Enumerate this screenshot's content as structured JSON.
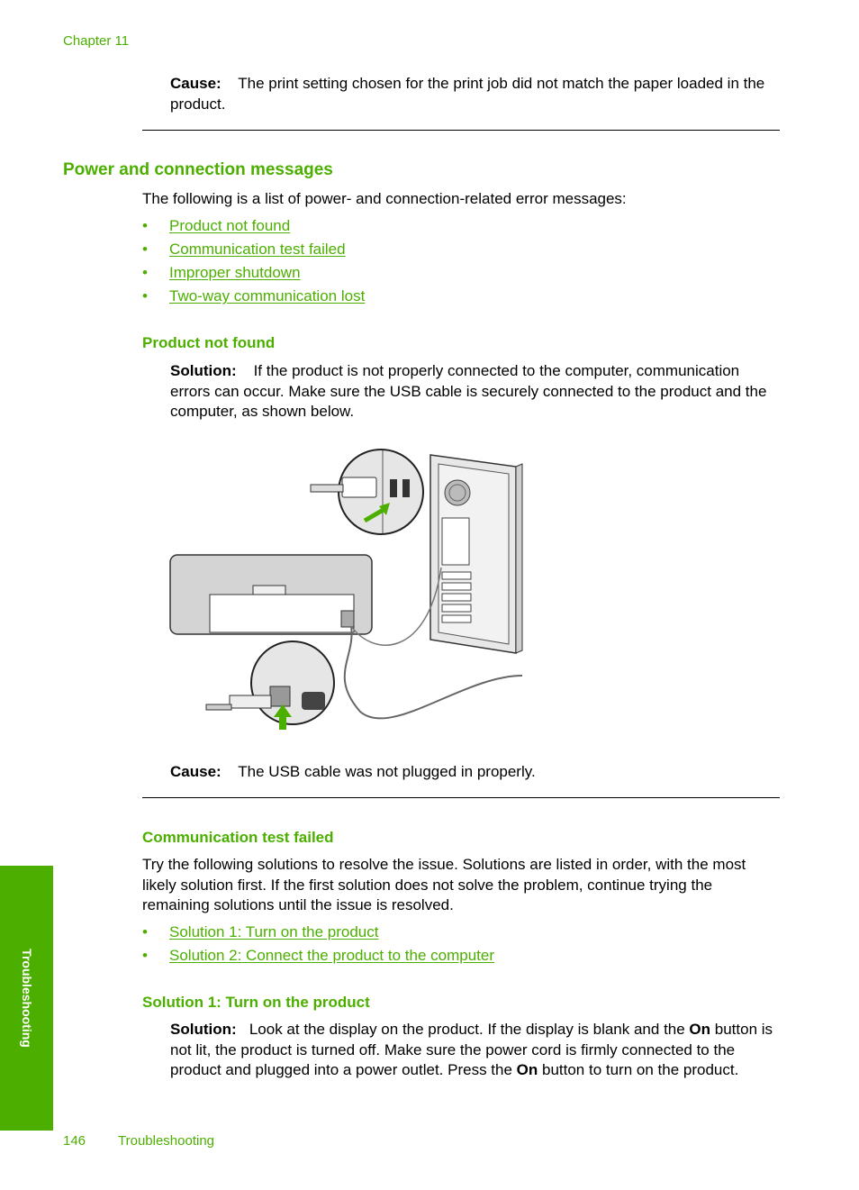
{
  "header": {
    "chapter": "Chapter 11"
  },
  "top_cause": {
    "label": "Cause:",
    "text": "The print setting chosen for the print job did not match the paper loaded in the product."
  },
  "section": {
    "title": "Power and connection messages",
    "intro": "The following is a list of power- and connection-related error messages:",
    "links": [
      "Product not found",
      "Communication test failed",
      "Improper shutdown",
      "Two-way communication lost"
    ]
  },
  "product_not_found": {
    "title": "Product not found",
    "solution_label": "Solution:",
    "solution_text": "If the product is not properly connected to the computer, communication errors can occur. Make sure the USB cable is securely connected to the product and the computer, as shown below.",
    "cause_label": "Cause:",
    "cause_text": "The USB cable was not plugged in properly."
  },
  "comm_test_failed": {
    "title": "Communication test failed",
    "intro": "Try the following solutions to resolve the issue. Solutions are listed in order, with the most likely solution first. If the first solution does not solve the problem, continue trying the remaining solutions until the issue is resolved.",
    "links": [
      "Solution 1: Turn on the product",
      "Solution 2: Connect the product to the computer"
    ]
  },
  "solution1": {
    "title": "Solution 1: Turn on the product",
    "label": "Solution:",
    "text_a": "Look at the display on the product. If the display is blank and the ",
    "bold_on_1": "On",
    "text_b": " button is not lit, the product is turned off. Make sure the power cord is firmly connected to the product and plugged into a power outlet. Press the ",
    "bold_on_2": "On",
    "text_c": " button to turn on the product."
  },
  "sidebar": {
    "label": "Troubleshooting"
  },
  "footer": {
    "page_number": "146",
    "section": "Troubleshooting"
  },
  "colors": {
    "accent": "#4caf00"
  }
}
